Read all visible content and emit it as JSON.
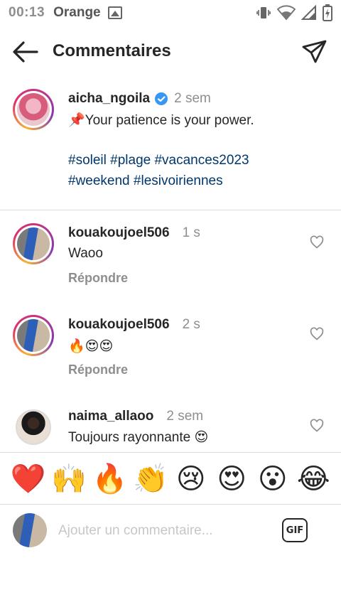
{
  "status_bar": {
    "time": "00:13",
    "carrier": "Orange"
  },
  "header": {
    "title": "Commentaires"
  },
  "caption": {
    "username": "aicha_ngoila",
    "verified": true,
    "time": "2 sem",
    "text": "📌Your patience is your power.",
    "hashtags_line1": "#soleil #plage #vacances2023",
    "hashtags_line2": "#weekend #lesivoiriennes"
  },
  "comments": [
    {
      "username": "kouakoujoel506",
      "time": "1 s",
      "text": "Waoo",
      "reply_label": "Répondre"
    },
    {
      "username": "kouakoujoel506",
      "time": "2 s",
      "text": "🔥😍😍",
      "reply_label": "Répondre"
    },
    {
      "username": "naima_allaoo",
      "time": "2 sem",
      "text": "Toujours rayonnante 😍"
    }
  ],
  "emoji_bar": [
    "❤️",
    "🙌",
    "🔥",
    "👏",
    "😢",
    "😍",
    "😮",
    "😂"
  ],
  "input": {
    "placeholder": "Ajouter un commentaire...",
    "gif_label": "GIF"
  },
  "colors": {
    "hashtag": "#00376b",
    "verified": "#3897f0",
    "secondary_text": "#8e8e8e"
  }
}
